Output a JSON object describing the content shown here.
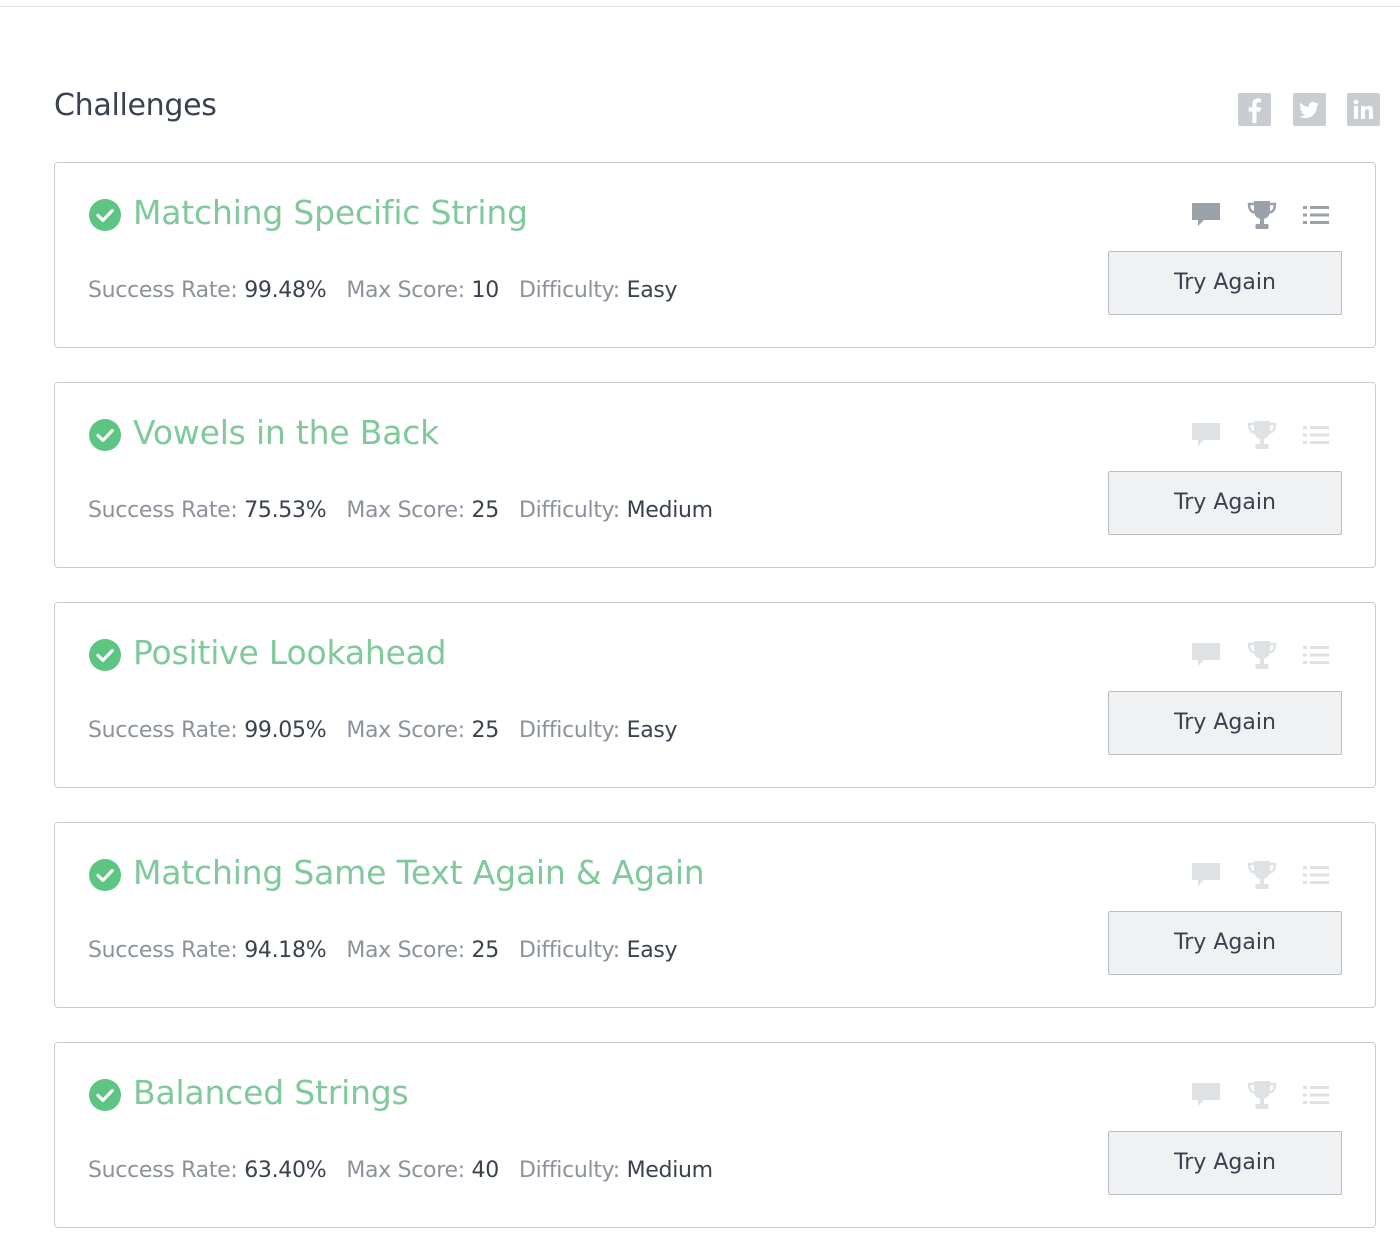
{
  "page": {
    "title": "Challenges",
    "social": [
      {
        "network": "facebook",
        "icon": "facebook-icon"
      },
      {
        "network": "twitter",
        "icon": "twitter-icon"
      },
      {
        "network": "linkedin",
        "icon": "linkedin-icon"
      }
    ]
  },
  "labels": {
    "success_rate": "Success Rate:",
    "max_score": "Max Score:",
    "difficulty": "Difficulty:",
    "try_again": "Try Again"
  },
  "colors": {
    "solved_green": "#5cc582",
    "title_green": "#7fc99b",
    "icon_active": "#9aa1a9",
    "icon_inactive": "#dfe2e5",
    "text_dark": "#39424e",
    "text_muted": "#8b929b"
  },
  "challenges": [
    {
      "name": "Matching Specific String",
      "success_rate": "99.48%",
      "max_score": "10",
      "difficulty": "Easy",
      "status_icon": "check-circle-icon",
      "icons_active": true
    },
    {
      "name": "Vowels in the Back",
      "success_rate": "75.53%",
      "max_score": "25",
      "difficulty": "Medium",
      "status_icon": "check-circle-icon",
      "icons_active": false
    },
    {
      "name": "Positive Lookahead",
      "success_rate": "99.05%",
      "max_score": "25",
      "difficulty": "Easy",
      "status_icon": "check-circle-icon",
      "icons_active": false
    },
    {
      "name": "Matching Same Text Again & Again",
      "success_rate": "94.18%",
      "max_score": "25",
      "difficulty": "Easy",
      "status_icon": "check-circle-icon",
      "icons_active": false
    },
    {
      "name": "Balanced Strings",
      "success_rate": "63.40%",
      "max_score": "40",
      "difficulty": "Medium",
      "status_icon": "check-circle-icon",
      "icons_active": false
    }
  ],
  "card_icons": [
    "discussion-icon",
    "trophy-icon",
    "list-icon"
  ]
}
